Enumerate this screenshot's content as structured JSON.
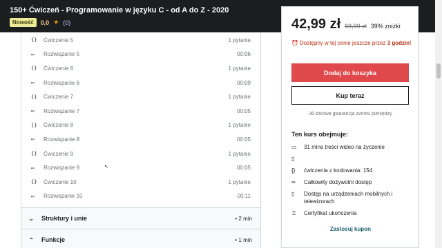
{
  "header": {
    "course_title": "150+ Ćwiczeń - Programowanie w języku C - od A do Z - 2020",
    "badge": "Nowość",
    "rating": "0,0",
    "star": "★",
    "rating_count": "(0)"
  },
  "curriculum": {
    "lectures": [
      {
        "icon": "{}",
        "title": "Ćwiczenie 5",
        "meta": "1 pytanie"
      },
      {
        "icon": "▭",
        "title": "Rozwiązanie 5",
        "meta": "00:06"
      },
      {
        "icon": "{}",
        "title": "Ćwiczenie 6",
        "meta": "1 pytanie"
      },
      {
        "icon": "▭",
        "title": "Rozwiązanie 6",
        "meta": "00:09"
      },
      {
        "icon": "{}",
        "title": "Ćwiczenie 7",
        "meta": "1 pytanie"
      },
      {
        "icon": "▭",
        "title": "Rozwiązanie 7",
        "meta": "00:05"
      },
      {
        "icon": "{}",
        "title": "Ćwiczenie 8",
        "meta": "1 pytanie"
      },
      {
        "icon": "▭",
        "title": "Rozwiązanie 8",
        "meta": "00:05"
      },
      {
        "icon": "{}",
        "title": "Ćwiczenie 9",
        "meta": "1 pytanie"
      },
      {
        "icon": "▭",
        "title": "Rozwiązanie 9",
        "meta": "00:05"
      },
      {
        "icon": "{}",
        "title": "Ćwiczenie 10",
        "meta": "1 pytanie"
      },
      {
        "icon": "▭",
        "title": "Rozwiązanie 10",
        "meta": "00:11"
      }
    ],
    "sections": [
      {
        "chevron": "⌄",
        "title": "Struktury i unie",
        "meta": "• 2 min"
      },
      {
        "chevron": "⌃",
        "title": "Funkcje",
        "meta": "• 1 min"
      }
    ]
  },
  "purchase": {
    "price_current": "42,99 zł",
    "price_original": "69,99 zł",
    "discount": "39% zniżki",
    "timer_prefix": "Dostępny w tej cenie jeszcze przez",
    "timer_value": "3 godzin",
    "timer_suffix": "!",
    "add_to_cart": "Dodaj do koszyka",
    "buy_now": "Kup teraz",
    "guarantee": "30-dniowa gwarancja zwrotu pieniędzy",
    "includes_title": "Ten kurs obejmuje:",
    "includes": [
      {
        "icon": "video-icon",
        "glyph": "▭",
        "text": "31 mins treści wideo na życzenie"
      },
      {
        "icon": "file-icon",
        "glyph": "▯",
        "text": ""
      },
      {
        "icon": "code-icon",
        "glyph": "{}",
        "text": "ćwiczenia z kodowania: 154"
      },
      {
        "icon": "infinity-icon",
        "glyph": "∞",
        "text": "Całkowity dożywotni dostęp"
      },
      {
        "icon": "mobile-icon",
        "glyph": "▯",
        "text": "Dostęp na urządzeniach mobilnych i telewizorach"
      },
      {
        "icon": "certificate-icon",
        "glyph": "♖",
        "text": "Certyfikat ukończenia"
      }
    ],
    "coupon": "Zastosuj kupon"
  },
  "colors": {
    "accent_red": "#e0494b",
    "link_teal": "#1c5f6e",
    "timer_red": "#b32d0f"
  }
}
